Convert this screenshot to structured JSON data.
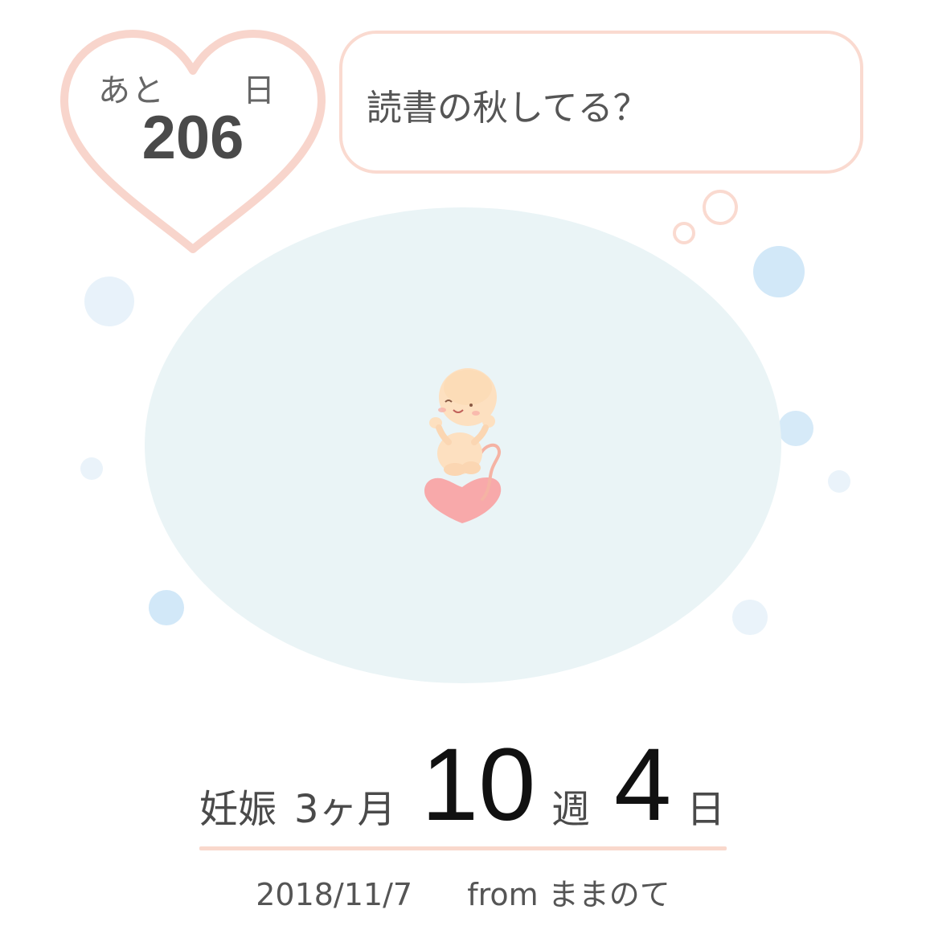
{
  "countdown": {
    "prefix": "あと",
    "suffix": "日",
    "days_remaining": "206"
  },
  "speech_bubble": {
    "message": "読書の秋してる？"
  },
  "pregnancy": {
    "label": "妊娠",
    "month": "3ヶ月",
    "weeks": "10",
    "week_unit": "週",
    "days": "4",
    "day_unit": "日"
  },
  "footer": {
    "date": "2018/11/7",
    "source": "from ままのて"
  },
  "colors": {
    "heart_outline": "#f8d5cc",
    "bubble_border": "#fadad0",
    "womb_fill": "#eaf4f6",
    "bubble_dots": "#d6eaf8",
    "accent_line": "#f9d8cc",
    "big_number": "#111111"
  },
  "icons": [
    "heart-frame-icon",
    "thought-bubble-icon",
    "baby-illustration",
    "pink-heart-icon"
  ]
}
